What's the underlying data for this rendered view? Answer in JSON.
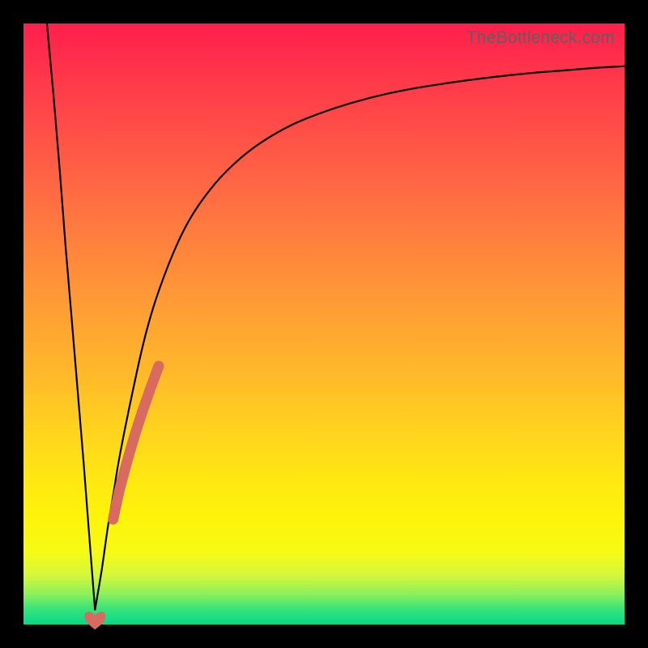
{
  "watermark": "TheBottleneck.com",
  "colors": {
    "curve": "#000000",
    "band": "#d86a60",
    "background_top": "#ff1f4d",
    "background_bottom": "#06d88a"
  },
  "chart_data": {
    "type": "line",
    "title": "",
    "xlabel": "",
    "ylabel": "",
    "xlim": [
      0,
      100
    ],
    "ylim": [
      0,
      100
    ],
    "series": [
      {
        "name": "left-descent",
        "x": [
          3.9,
          5.0,
          6.0,
          7.0,
          8.0,
          9.0,
          10.0,
          11.0,
          11.9
        ],
        "y": [
          100,
          88,
          76,
          63,
          51,
          39,
          27,
          14,
          2.5
        ]
      },
      {
        "name": "right-curve",
        "x": [
          11.9,
          13,
          14,
          15,
          16,
          18,
          20,
          22,
          25,
          28,
          32,
          36,
          40,
          45,
          50,
          55,
          60,
          65,
          70,
          75,
          80,
          85,
          90,
          95,
          100
        ],
        "y": [
          2.5,
          9,
          16,
          22,
          28,
          38,
          47,
          54,
          62,
          68,
          73.5,
          77.5,
          80.5,
          83.3,
          85.3,
          86.9,
          88.2,
          89.2,
          90.0,
          90.7,
          91.3,
          91.8,
          92.2,
          92.6,
          92.9
        ]
      },
      {
        "name": "highlight-band",
        "x": [
          14.9,
          16.0,
          17.2,
          18.5,
          19.8,
          21.2,
          22.5
        ],
        "y": [
          17.5,
          22.5,
          27.0,
          31.5,
          35.5,
          39.5,
          43.0
        ]
      },
      {
        "name": "heart",
        "x": [
          11.9
        ],
        "y": [
          2.0
        ]
      }
    ],
    "gradient_stops": [
      {
        "pos": 0.0,
        "color": "#ff1f4d"
      },
      {
        "pos": 0.34,
        "color": "#ff7b3f"
      },
      {
        "pos": 0.68,
        "color": "#ffd41e"
      },
      {
        "pos": 0.88,
        "color": "#f6fb15"
      },
      {
        "pos": 1.0,
        "color": "#06d88a"
      }
    ]
  }
}
